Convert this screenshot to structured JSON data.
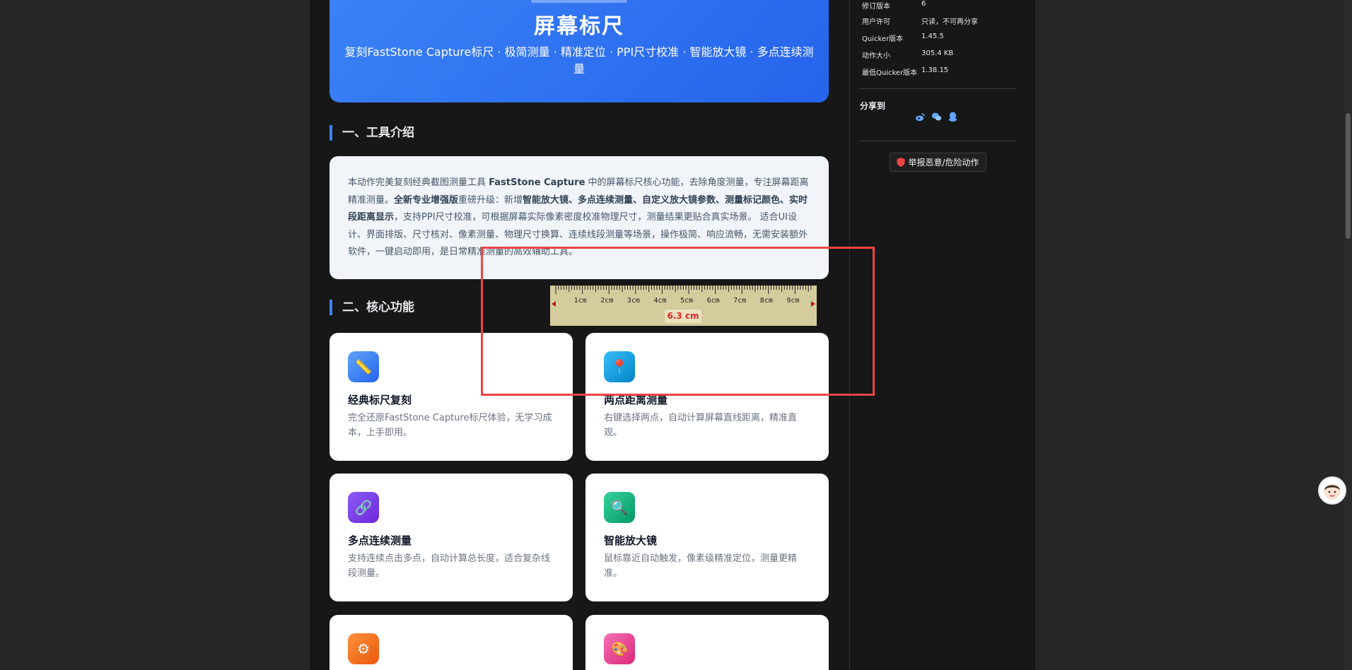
{
  "hero": {
    "title": "屏幕标尺",
    "subtitle": "复刻FastStone Capture标尺 · 极简测量 · 精准定位 · PPI尺寸校准 · 智能放大镜 · 多点连续测量"
  },
  "sections": {
    "intro_heading": "一、工具介绍",
    "features_heading": "二、核心功能"
  },
  "intro": {
    "p1": "本动作完美复刻经典截图测量工具 ",
    "brand": "FastStone Capture",
    "p2": " 中的屏幕标尺核心功能，去除角度测量，专注屏幕距离精准测量。",
    "upgrade_bold": "全新专业增强版",
    "p3": "重磅升级：新增",
    "features_bold1": "智能放大镜、多点连续测量、自定义放大镜参数、测量标记颜色、实时段距离显示",
    "p4": "，支持PPI尺寸校准，可根据屏幕实际像素密度校准物理尺寸，测量结果更贴合真实场景。 适合UI设计、界面排版、尺寸核对、像素测量、物理尺寸换算、连续线段测量等场景，操作极简、响应流畅，无需安装额外软件，一键启动即用，是日常精准测量的高效辅助工具。"
  },
  "features": [
    {
      "title": "经典标尺复刻",
      "desc": "完全还原FastStone Capture标尺体验，无学习成本，上手即用。",
      "icon": "ruler-icon",
      "glyph": "📏",
      "color": "#3b82f6"
    },
    {
      "title": "两点距离测量",
      "desc": "右键选择两点，自动计算屏幕直线距离，精准直观。",
      "icon": "pin-icon",
      "glyph": "📍",
      "color": "#0ea5e9"
    },
    {
      "title": "多点连续测量",
      "desc": "支持连续点击多点，自动计算总长度，适合复杂线段测量。",
      "icon": "link-icon",
      "glyph": "🔗",
      "color": "#7c3aed"
    },
    {
      "title": "智能放大镜",
      "desc": "鼠标靠近自动触发，像素级精准定位，测量更精准。",
      "icon": "magnifier-icon",
      "glyph": "🔍",
      "color": "#10b981"
    },
    {
      "title": "",
      "desc": "",
      "icon": "gear-icon",
      "glyph": "⚙",
      "color": "#f97316"
    },
    {
      "title": "",
      "desc": "",
      "icon": "palette-icon",
      "glyph": "🎨",
      "color": "#ec4899"
    }
  ],
  "ruler": {
    "labels": [
      "1cm",
      "2cm",
      "3cm",
      "4cm",
      "5cm",
      "6cm",
      "7cm",
      "8cm",
      "9cm"
    ],
    "measurement": "6.3 cm"
  },
  "sidebar": {
    "meta": [
      {
        "key": "修订版本",
        "value": "6"
      },
      {
        "key": "用户许可",
        "value": "只读，不可再分享"
      },
      {
        "key": "Quicker版本",
        "value": "1.45.5"
      },
      {
        "key": "动作大小",
        "value": "305.4 KB"
      },
      {
        "key": "最低Quicker版本",
        "value": "1.38.15"
      }
    ],
    "share_title": "分享到",
    "share_icons": [
      "weibo-icon",
      "wechat-icon",
      "qq-icon"
    ],
    "report_label": "举报恶意/危险动作"
  },
  "colors": {
    "hero_start": "#3b82f6",
    "hero_end": "#2563eb",
    "accent": "#3b82f6",
    "measure_frame": "#ef4444",
    "ruler_bg": "#d4cc9c"
  }
}
